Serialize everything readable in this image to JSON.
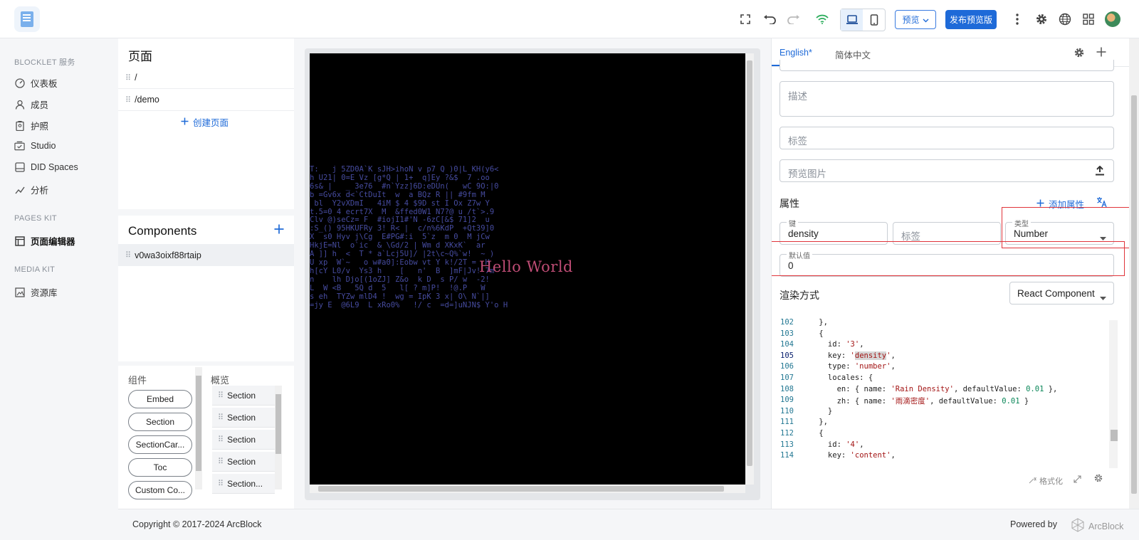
{
  "topbar": {
    "preview_label": "预览",
    "publish_label": "发布预览版"
  },
  "leftnav": {
    "sections": [
      {
        "title": "BLOCKLET 服务",
        "items": [
          {
            "label": "仪表板",
            "icon": "dashboard-icon"
          },
          {
            "label": "成员",
            "icon": "user-icon"
          },
          {
            "label": "护照",
            "icon": "passport-icon"
          },
          {
            "label": "Studio",
            "icon": "studio-icon"
          },
          {
            "label": "DID Spaces",
            "icon": "spaces-icon"
          },
          {
            "label": "分析",
            "icon": "analytics-icon"
          }
        ]
      },
      {
        "title": "PAGES KIT",
        "items": [
          {
            "label": "页面编辑器",
            "icon": "page-editor-icon",
            "active": true
          }
        ]
      },
      {
        "title": "MEDIA KIT",
        "items": [
          {
            "label": "资源库",
            "icon": "media-library-icon"
          }
        ]
      }
    ]
  },
  "pages": {
    "title": "页面",
    "rows": [
      "/",
      "/demo"
    ],
    "create_label": "创建页面"
  },
  "components": {
    "title": "Components",
    "rows": [
      "v0wa3oixf88rtaip"
    ]
  },
  "library": {
    "components_head": "组件",
    "outline_head": "概览",
    "pills": [
      "Embed",
      "Section",
      "SectionCar...",
      "Toc",
      "Custom Co..."
    ],
    "outline": [
      "Section",
      "Section",
      "Section",
      "Section",
      "Section..."
    ]
  },
  "canvas": {
    "hello_text": "Hello World",
    "matrix_lines": [
      "T:   j 5ZD0A`K sJH>ihoN v p7 Q )0|L KH(y6<",
      "h U21| 0=E Vz [g*Q | 1+  q]Ey ?&$  7 .oo",
      "6s& |   _ 3e76  #n`Yzz]6D:eDUn(   wC 9O:|0",
      "b =Gv6x d<`CtDuIt  w  a BQz R || #9fm M",
      " bl  Y2vXDmI   4iM $ 4 $9D st I Ox Z7w Y",
      "t.5=0 4 ecrt7X  M  &ffed0W1 N7?@ u /t`>.9",
      "Clv @)seCz= F  #iojI1#'N -6zC[&$ 71]2  u",
      ":S_() 95HKUFRy 3! R< |  c/n%6KdP  +Qt39]0",
      "X  s0 Hyv j\\Cg  E#PG#:i  5`z  m 0  M jCw",
      "HkjE=Nl  o`ic  & \\Gd/2 | Wm d XKxK`  ar",
      "A ]] h  <  T * a`Lcj5U]/ |2t\\c~Q%`w!  ~ )",
      "U xp  W`~   o w#a0]:Eobw vt Y k!/2T =  H",
      "h[cY L0/v  Ys3 h    [   n'  B  ]mF|Jv! 7m",
      "n    lh Djo[(1oZJ] Z&o  k D  s P/ w  -2!",
      "L  W <B   5Q d  5   l[ ? m]P!  !@.P   W",
      "s eh  TYZw mlD4 !  wg = IpK 3 x| O\\ N`|]",
      "=jy E  @6L9  L xRo0%   !/ c  =d=]uNJN$ Y'o H"
    ]
  },
  "right": {
    "tabs": [
      {
        "label": "English*",
        "active": true
      },
      {
        "label": "简体中文"
      }
    ],
    "description_placeholder": "描述",
    "tags_placeholder": "标签",
    "preview_image_placeholder": "预览图片",
    "properties_title": "属性",
    "add_property_label": "添加属性",
    "key_legend": "键",
    "key_value": "density",
    "label_placeholder": "标签",
    "type_legend": "类型",
    "type_value": "Number",
    "default_legend": "默认值",
    "default_value": "0",
    "render_title": "渲染方式",
    "render_value": "React Component",
    "format_label": "格式化",
    "code_lines": [
      {
        "n": "102",
        "t": "    },"
      },
      {
        "n": "103",
        "t": "    {"
      },
      {
        "n": "104",
        "t": "      id: '3',"
      },
      {
        "n": "105",
        "t": "      key: 'density',"
      },
      {
        "n": "106",
        "t": "      type: 'number',"
      },
      {
        "n": "107",
        "t": "      locales: {"
      },
      {
        "n": "108",
        "t": "        en: { name: 'Rain Density', defaultValue: 0.01 },"
      },
      {
        "n": "109",
        "t": "        zh: { name: '雨滴密度', defaultValue: 0.01 }"
      },
      {
        "n": "110",
        "t": "      }"
      },
      {
        "n": "111",
        "t": "    },"
      },
      {
        "n": "112",
        "t": "    {"
      },
      {
        "n": "113",
        "t": "      id: '4',"
      },
      {
        "n": "114",
        "t": "      key: 'content',"
      }
    ]
  },
  "footer": {
    "copyright": "Copyright © 2017-2024  ArcBlock",
    "powered_by": "Powered by",
    "brand": "ArcBlock"
  }
}
